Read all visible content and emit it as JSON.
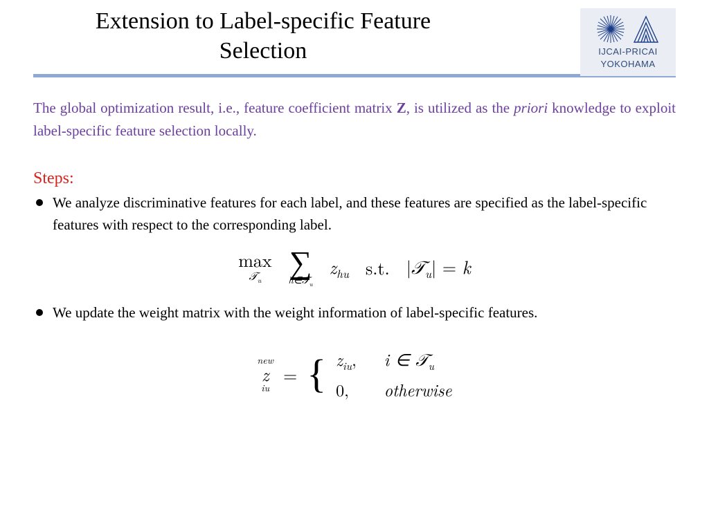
{
  "header": {
    "title": "Extension to Label-specific Feature Selection",
    "logo": {
      "line1": "IJCAI-PRICAI",
      "line2": "YOKOHAMA"
    }
  },
  "intro": {
    "pre": "The global optimization result, i.e., feature coefficient matrix ",
    "bold": "Z",
    "mid": ", is utilized as the ",
    "ital": "priori",
    "post": " knowledge to exploit label-specific feature selection locally."
  },
  "steps_heading": "Steps:",
  "bullets": {
    "b1": "We analyze discriminative features for each label, and these features are specified as the label-specific features with respect to the corresponding label.",
    "b2": "We update the weight matrix with the weight information of label-specific features."
  },
  "eq1": {
    "max": "max",
    "set": "𝒯",
    "set_sub": "u",
    "sum_under_pre": "h∈",
    "z": "z",
    "z_sub": "hu",
    "st": "s.t.",
    "bar1": "|",
    "bar2": "|",
    "eq": " = ",
    "k": "k"
  },
  "eq2": {
    "lhs_z": "z",
    "lhs_sup": "new",
    "lhs_sub": "iu",
    "equals": "=",
    "case1_val_z": "z",
    "case1_val_sub": "iu",
    "case1_comma": ",",
    "case1_cond_pre": "i ∈ ",
    "case1_cond_set": "𝒯",
    "case1_cond_sub": "u",
    "case2_val": "0,",
    "case2_cond": "otherwise"
  }
}
